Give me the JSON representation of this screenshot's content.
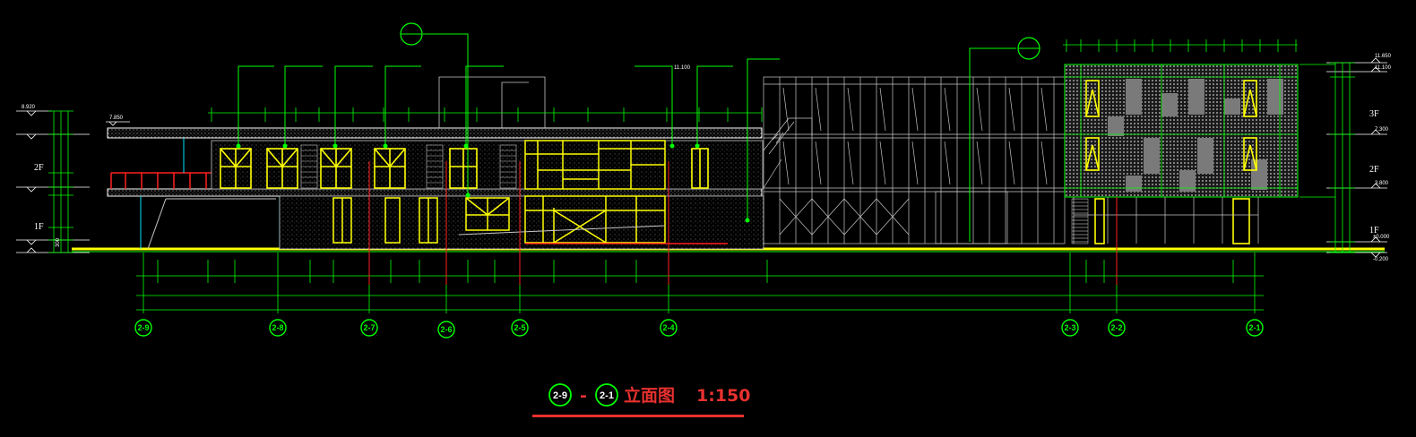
{
  "drawing": {
    "title": {
      "start_axis": "2-9",
      "dash": "-",
      "end_axis": "2-1",
      "name": "立面图",
      "scale": "1:150"
    },
    "grid_axes": [
      "2-9",
      "2-8",
      "2-7",
      "2-6",
      "2-5",
      "2-4",
      "2-3",
      "2-2",
      "2-1"
    ],
    "floor_labels": {
      "left": [
        "2F",
        "1F"
      ],
      "right": [
        "3F",
        "2F",
        "1F"
      ]
    },
    "elevations": {
      "left": [
        "8.920",
        "7.850",
        "300"
      ],
      "center": "11.100",
      "right": [
        "11.650",
        "11.100",
        "7.300",
        "3.800",
        "±0.000",
        "-0.200"
      ]
    },
    "colors": {
      "background": "#000000",
      "grid": "#00ff00",
      "window": "#ffff00",
      "accent": "#ff2020",
      "line": "#c8c8c8",
      "cyan": "#00e5ff",
      "title": "#e8312f"
    }
  }
}
